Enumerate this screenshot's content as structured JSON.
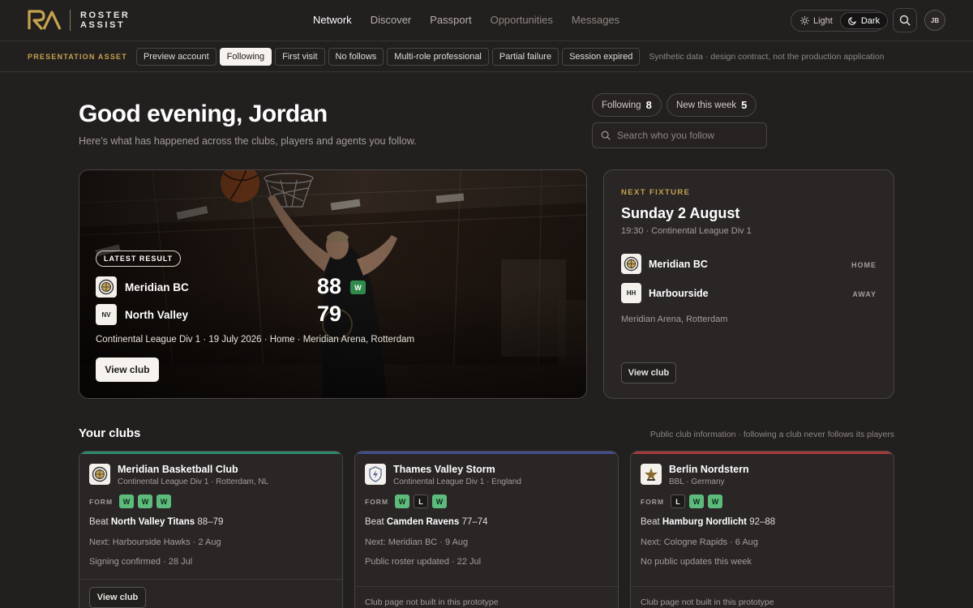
{
  "brand": {
    "line1": "ROSTER",
    "line2": "ASSIST"
  },
  "nav": [
    {
      "label": "Network",
      "state": "active"
    },
    {
      "label": "Discover",
      "state": "normal"
    },
    {
      "label": "Passport",
      "state": "normal"
    },
    {
      "label": "Opportunities",
      "state": "muted"
    },
    {
      "label": "Messages",
      "state": "muted"
    }
  ],
  "theme": {
    "light_label": "Light",
    "dark_label": "Dark",
    "selected": "Dark"
  },
  "user": {
    "initials": "JB"
  },
  "preview": {
    "label": "PRESENTATION ASSET",
    "chips": [
      "Preview account",
      "Following",
      "First visit",
      "No follows",
      "Multi-role professional",
      "Partial failure",
      "Session expired"
    ],
    "selected": "Following",
    "note": "Synthetic data · design contract, not the production application"
  },
  "greeting": {
    "title": "Good evening, Jordan",
    "subtitle": "Here’s what has happened across the clubs, players and agents you follow."
  },
  "stats": {
    "following_label": "Following",
    "following_count": "8",
    "new_label": "New this week",
    "new_count": "5"
  },
  "search": {
    "placeholder": "Search who you follow"
  },
  "latest_result": {
    "badge": "LATEST RESULT",
    "home": {
      "name": "Meridian BC",
      "crest": "",
      "score": "88",
      "result": "W"
    },
    "away": {
      "name": "North Valley",
      "crest": "NV",
      "score": "79"
    },
    "meta": "Continental League Div 1 · 19 July 2026 · Home · Meridian Arena, Rotterdam",
    "button": "View club"
  },
  "next_fixture": {
    "eyebrow": "NEXT FIXTURE",
    "date": "Sunday 2 August",
    "time": "19:30 · Continental League Div 1",
    "home": {
      "name": "Meridian BC",
      "tag": "HOME"
    },
    "away": {
      "name": "Harbourside",
      "crest": "HH",
      "tag": "AWAY"
    },
    "venue": "Meridian Arena, Rotterdam",
    "button": "View club"
  },
  "clubs_section": {
    "title": "Your clubs",
    "note": "Public club information · following a club never follows its players"
  },
  "clubs": [
    {
      "name": "Meridian Basketball Club",
      "league": "Continental League Div 1 · Rotterdam, NL",
      "accent": "#2f8a6e",
      "form_label": "FORM",
      "form": [
        "W",
        "W",
        "W"
      ],
      "result_prefix": "Beat",
      "result_team": "North Valley Titans",
      "result_score": "88–79",
      "next": "Next: Harbourside Hawks · 2 Aug",
      "update": "Signing confirmed · 28 Jul",
      "footer": "View club"
    },
    {
      "name": "Thames Valley Storm",
      "league": "Continental League Div 1 · England",
      "accent": "#3f4f8f",
      "form_label": "FORM",
      "form": [
        "W",
        "L",
        "W"
      ],
      "result_prefix": "Beat",
      "result_team": "Camden Ravens",
      "result_score": "77–74",
      "next": "Next: Meridian BC · 9 Aug",
      "update": "Public roster updated · 22 Jul",
      "footer": "Club page not built in this prototype"
    },
    {
      "name": "Berlin Nordstern",
      "league": "BBL · Germany",
      "accent": "#a63a3a",
      "form_label": "FORM",
      "form": [
        "L",
        "W",
        "W"
      ],
      "result_prefix": "Beat",
      "result_team": "Hamburg Nordlicht",
      "result_score": "92–88",
      "next": "Next: Cologne Rapids · 6 Aug",
      "update": "No public updates this week",
      "footer": "Club page not built in this prototype"
    }
  ]
}
